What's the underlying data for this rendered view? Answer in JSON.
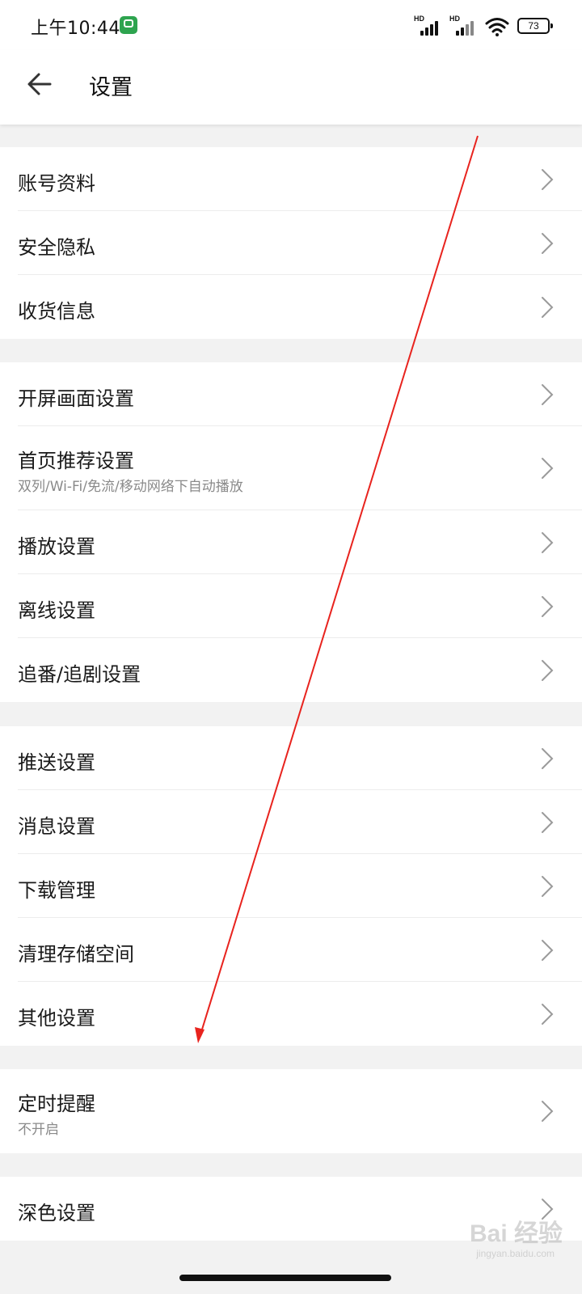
{
  "status_bar": {
    "time": "上午10:44",
    "signal_label_1": "HD",
    "signal_label_2": "HD",
    "battery": "73"
  },
  "header": {
    "title": "设置"
  },
  "groups": [
    {
      "items": [
        {
          "label": "账号资料"
        },
        {
          "label": "安全隐私"
        },
        {
          "label": "收货信息"
        }
      ]
    },
    {
      "items": [
        {
          "label": "开屏画面设置"
        },
        {
          "label": "首页推荐设置",
          "sub": "双列/Wi-Fi/免流/移动网络下自动播放"
        },
        {
          "label": "播放设置"
        },
        {
          "label": "离线设置"
        },
        {
          "label": "追番/追剧设置"
        }
      ]
    },
    {
      "items": [
        {
          "label": "推送设置"
        },
        {
          "label": "消息设置"
        },
        {
          "label": "下载管理"
        },
        {
          "label": "清理存储空间"
        },
        {
          "label": "其他设置"
        }
      ]
    },
    {
      "items": [
        {
          "label": "定时提醒",
          "sub": "不开启"
        }
      ]
    },
    {
      "items": [
        {
          "label": "深色设置"
        }
      ]
    }
  ],
  "watermark": {
    "text": "Bai 经验",
    "sub": "jingyan.baidu.com"
  },
  "colors": {
    "background": "#f2f2f2",
    "surface": "#ffffff",
    "annotation_arrow": "#e8231e",
    "secondary_text": "#8a8a8a"
  }
}
